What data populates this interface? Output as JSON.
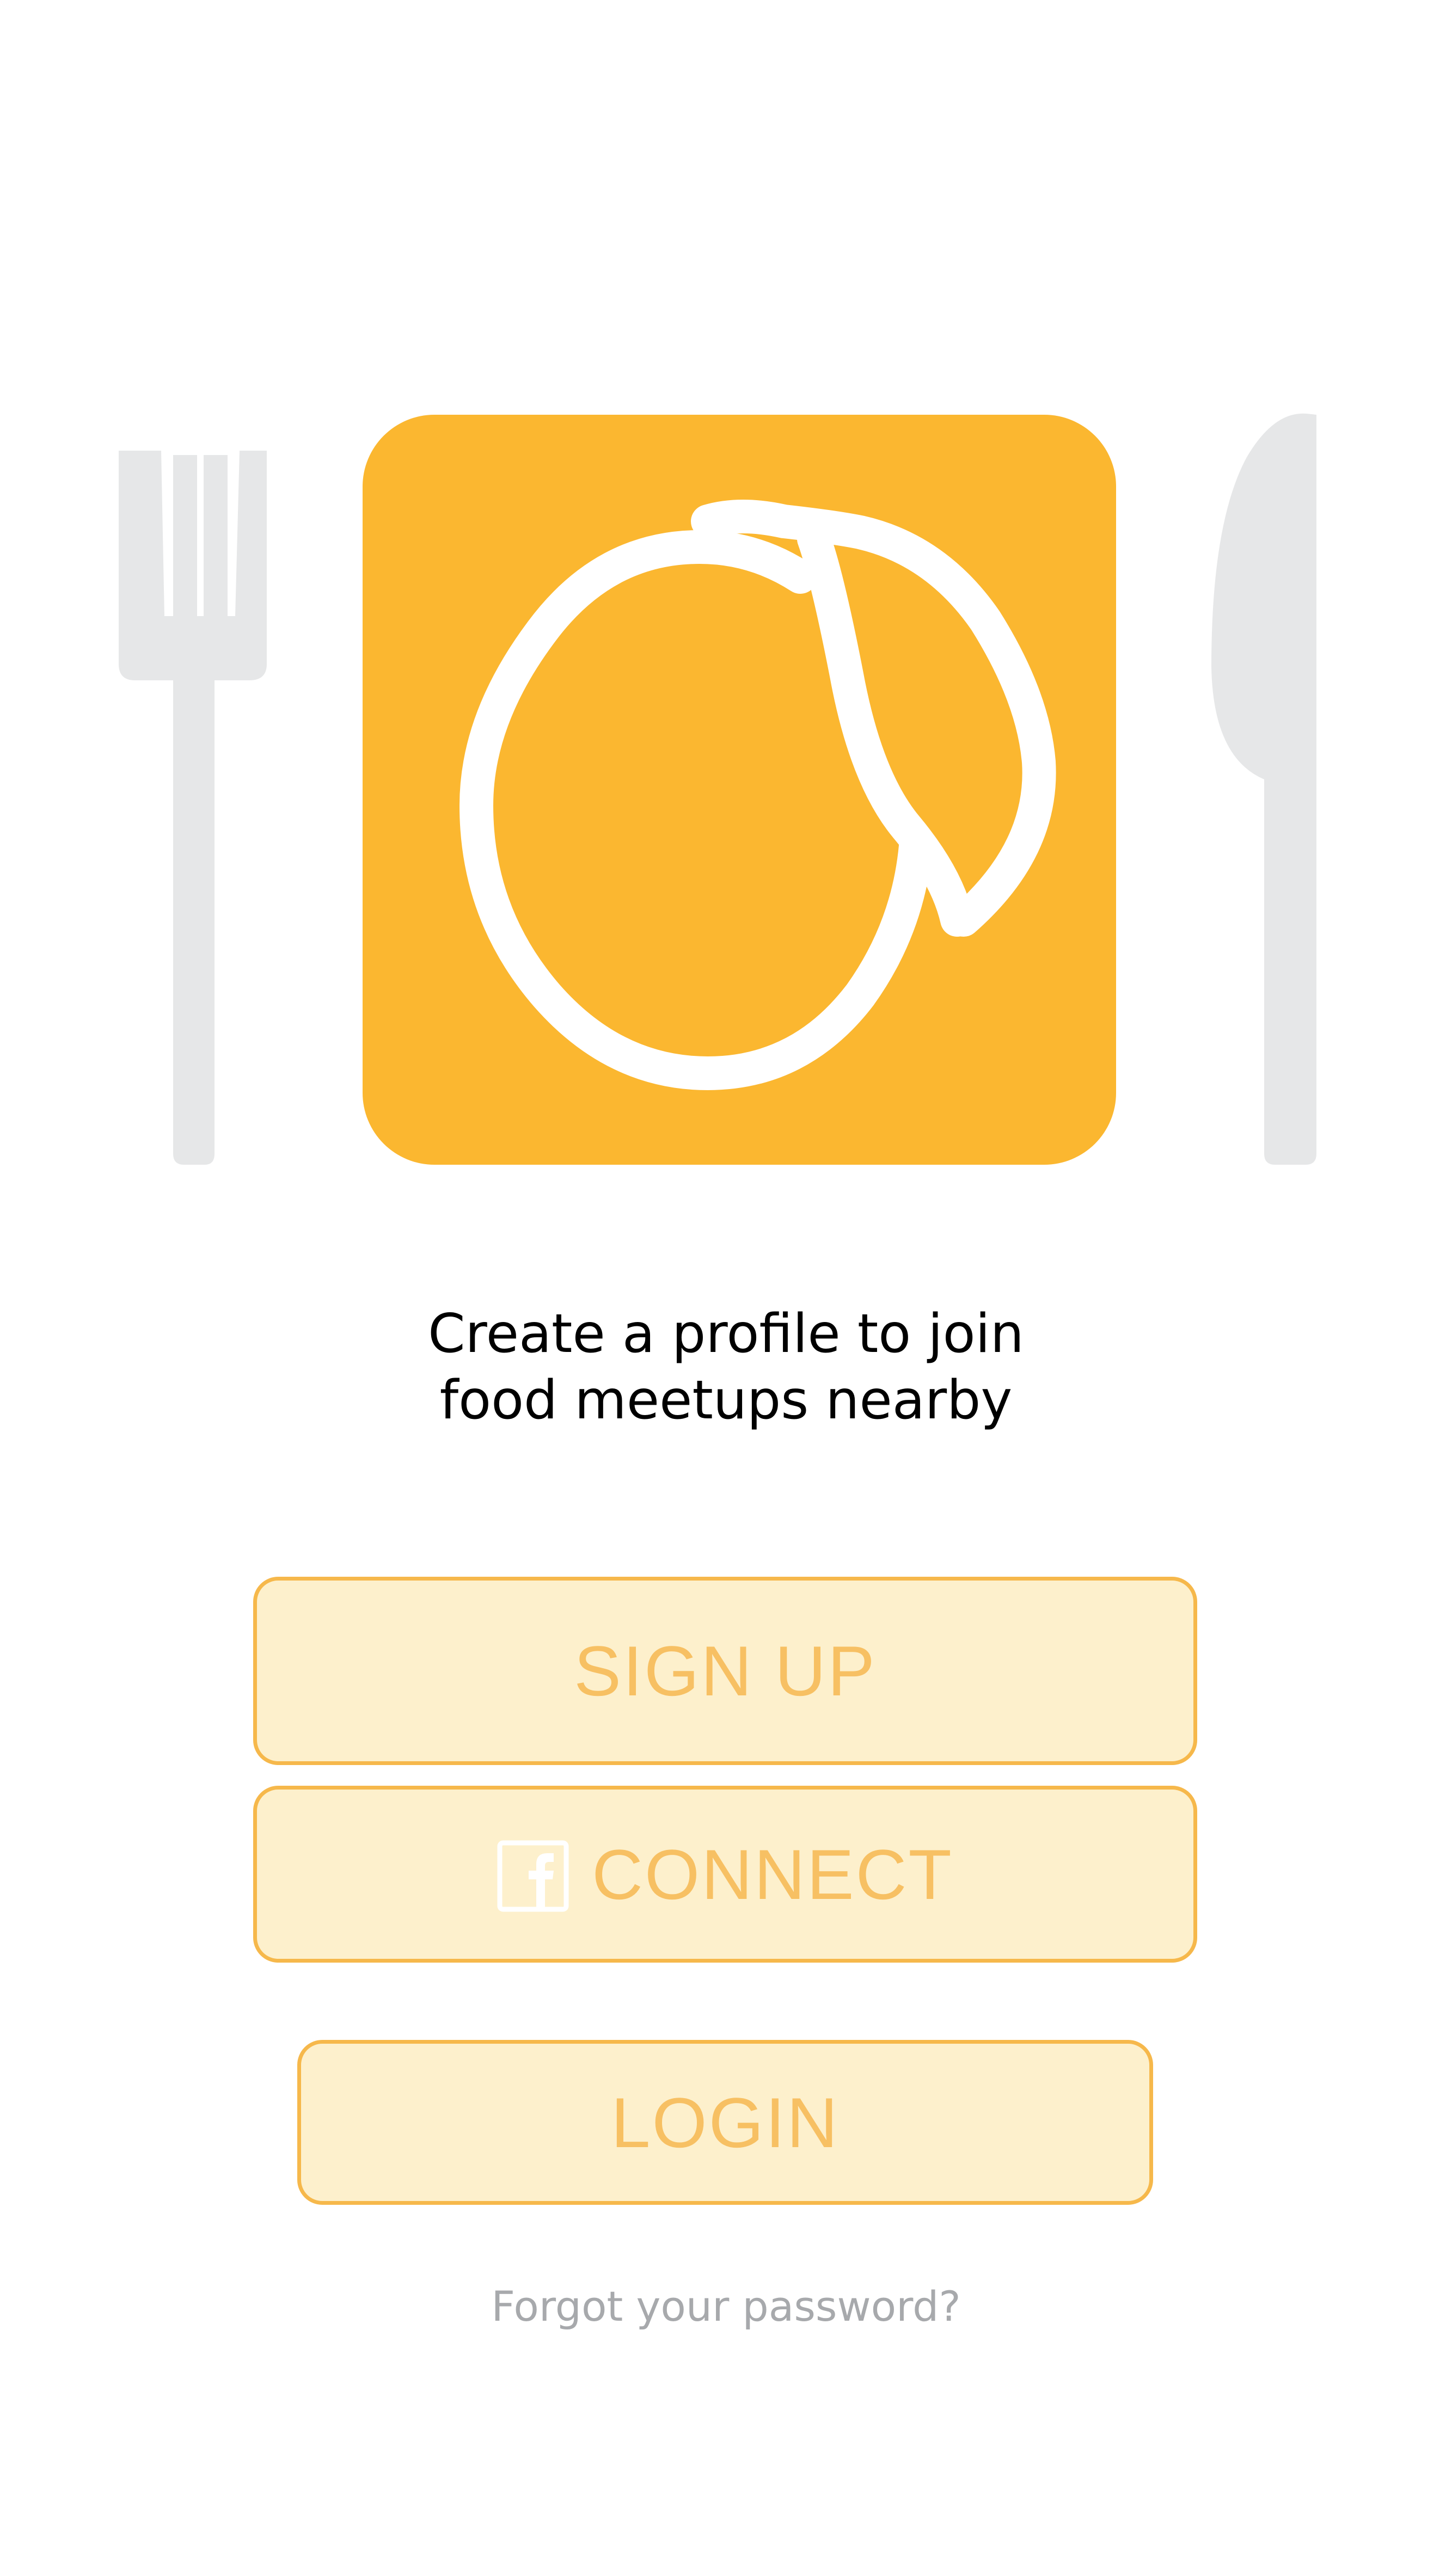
{
  "colors": {
    "brand_orange": "#fbb730",
    "utensil_gray": "#e6e7e8",
    "button_fill": "#fdf0cc",
    "button_border": "#f6b84b",
    "button_text": "#f7c063",
    "link_gray": "#a7a9ac"
  },
  "icons": {
    "fork": "fork-icon",
    "logo": "mango-logo",
    "knife": "knife-icon",
    "facebook": "facebook-icon"
  },
  "intro": {
    "line1": "Create a profile to join",
    "line2": "food meetups nearby"
  },
  "buttons": {
    "signup_label": "SIGN UP",
    "connect_label": "CONNECT",
    "login_label": "LOGIN"
  },
  "links": {
    "forgot_password": "Forgot your password?"
  }
}
